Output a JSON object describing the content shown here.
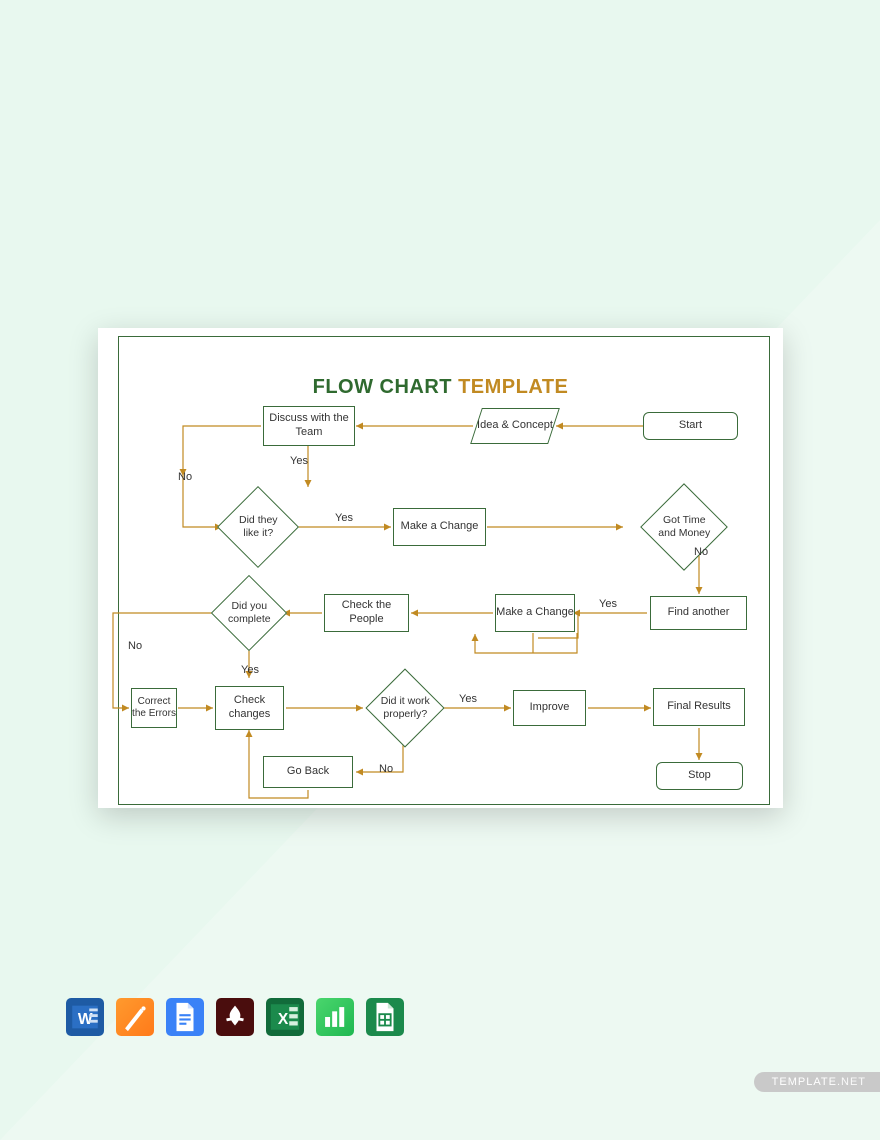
{
  "title": {
    "a": "FLOW CHART ",
    "b": "TEMPLATE"
  },
  "nodes": {
    "start": "Start",
    "idea": "Idea & Concept",
    "discuss": "Discuss with the Team",
    "like": "Did they like it?",
    "change1": "Make a Change",
    "time": "Got Time and Money",
    "find": "Find another",
    "change2": "Make a Change",
    "people": "Check the People",
    "complete": "Did you complete",
    "errors": "Correct the Errors",
    "check": "Check changes",
    "work": "Did it work properly?",
    "improve": "Improve",
    "final": "Final Results",
    "back": "Go Back",
    "stop": "Stop"
  },
  "labels": {
    "no1": "No",
    "yes1": "Yes",
    "yes2_dup": "Yes",
    "yes2": "Yes",
    "no2": "No",
    "yes3": "Yes",
    "no3": "No",
    "yes4": "Yes",
    "no4": "No"
  },
  "watermark": {
    "a": "TEMPLATE",
    "b": ".NET"
  },
  "icons": [
    "word",
    "pages",
    "gdocs",
    "pdf",
    "excel",
    "numbers",
    "gsheets"
  ]
}
